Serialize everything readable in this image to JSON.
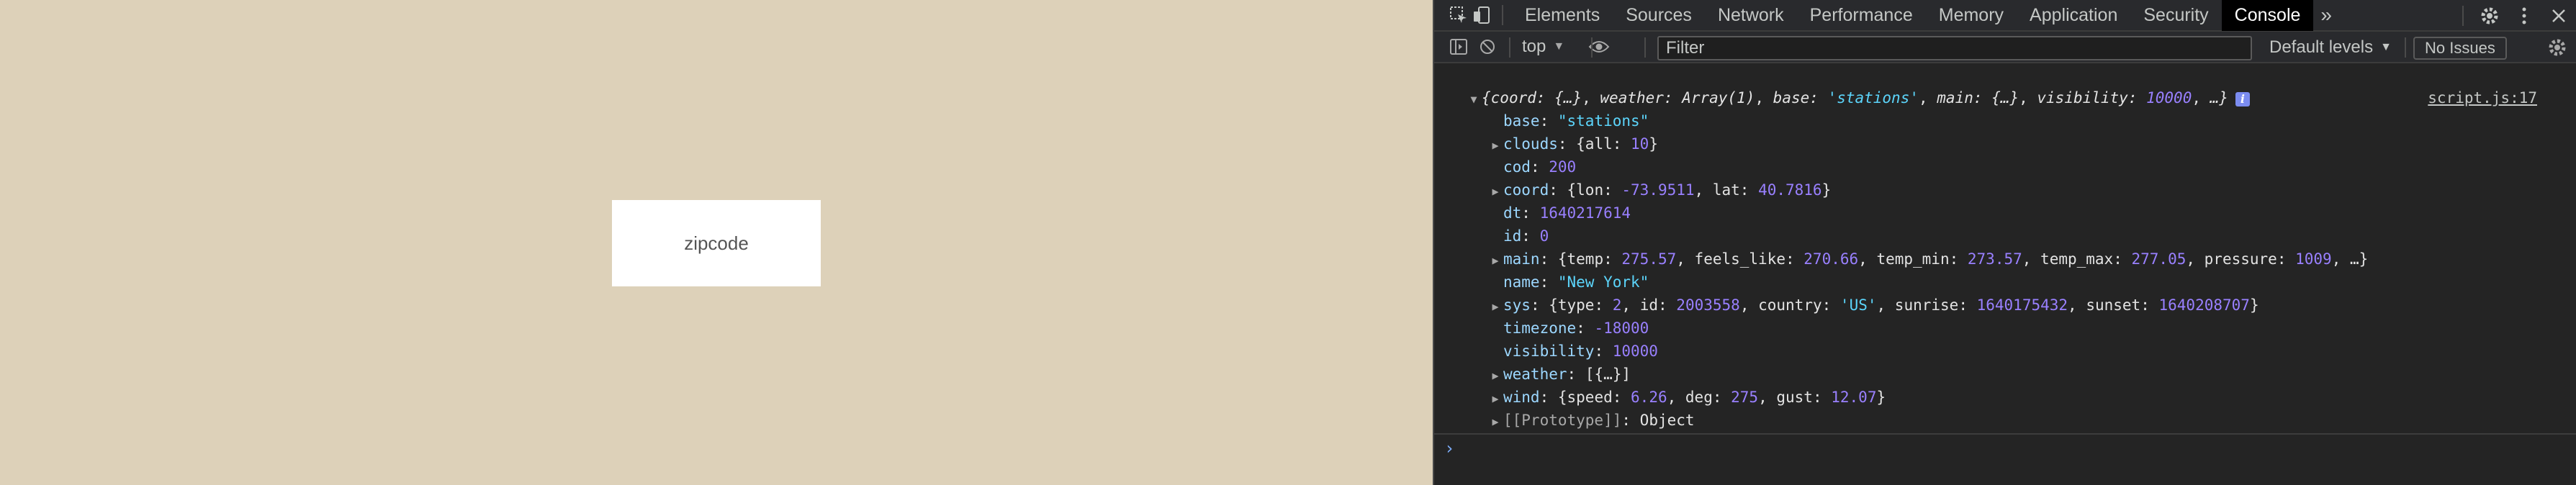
{
  "page": {
    "zip_placeholder": "zipcode"
  },
  "devtools": {
    "tabs": [
      {
        "label": "Elements"
      },
      {
        "label": "Sources"
      },
      {
        "label": "Network"
      },
      {
        "label": "Performance"
      },
      {
        "label": "Memory"
      },
      {
        "label": "Application"
      },
      {
        "label": "Security"
      },
      {
        "label": "Console",
        "active": true
      }
    ],
    "more_tabs": "»",
    "toolbar": {
      "context": "top",
      "filter_placeholder": "Filter",
      "levels": "Default levels",
      "issues": "No Issues"
    },
    "console": {
      "source": "script.js:17",
      "summary": {
        "open": "{",
        "coord_key": "coord",
        "coord_val": "{…}",
        "weather_key": "weather",
        "weather_val": "Array(1)",
        "base_key": "base",
        "base_val": "'stations'",
        "main_key": "main",
        "main_val": "{…}",
        "visibility_key": "visibility",
        "visibility_val": "10000",
        "tail": "…}"
      },
      "props": {
        "base": {
          "key": "base",
          "value": "\"stations\""
        },
        "clouds": {
          "key": "clouds",
          "k1": "all",
          "v1": "10"
        },
        "cod": {
          "key": "cod",
          "value": "200"
        },
        "coord": {
          "key": "coord",
          "k1": "lon",
          "v1": "-73.9511",
          "k2": "lat",
          "v2": "40.7816"
        },
        "dt": {
          "key": "dt",
          "value": "1640217614"
        },
        "id": {
          "key": "id",
          "value": "0"
        },
        "main": {
          "key": "main",
          "k1": "temp",
          "v1": "275.57",
          "k2": "feels_like",
          "v2": "270.66",
          "k3": "temp_min",
          "v3": "273.57",
          "k4": "temp_max",
          "v4": "277.05",
          "k5": "pressure",
          "v5": "1009",
          "tail": "…"
        },
        "name": {
          "key": "name",
          "value": "\"New York\""
        },
        "sys": {
          "key": "sys",
          "k1": "type",
          "v1": "2",
          "k2": "id",
          "v2": "2003558",
          "k3": "country",
          "v3": "'US'",
          "k4": "sunrise",
          "v4": "1640175432",
          "k5": "sunset",
          "v5": "1640208707"
        },
        "timezone": {
          "key": "timezone",
          "value": "-18000"
        },
        "visibility": {
          "key": "visibility",
          "value": "10000"
        },
        "weather": {
          "key": "weather",
          "value": "[{…}]"
        },
        "wind": {
          "key": "wind",
          "k1": "speed",
          "v1": "6.26",
          "k2": "deg",
          "v2": "275",
          "k3": "gust",
          "v3": "12.07"
        },
        "prototype": {
          "key": "[[Prototype]]",
          "value": "Object"
        }
      },
      "prompt": "›"
    },
    "icons": {
      "inspect": "inspect-icon",
      "device": "device-toggle-icon",
      "settings": "gear-icon",
      "menu": "kebab-menu-icon",
      "close": "close-icon",
      "sidebar": "sidebar-toggle-icon",
      "clear": "clear-console-icon",
      "eye": "live-expression-icon"
    }
  }
}
